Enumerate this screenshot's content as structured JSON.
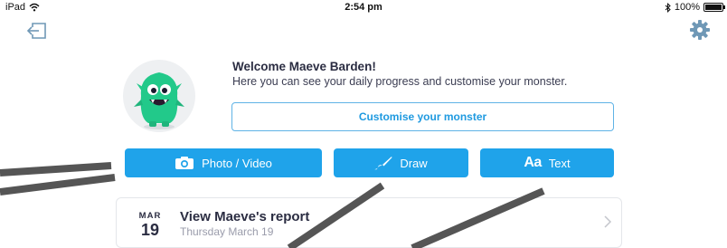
{
  "status_bar": {
    "device": "iPad",
    "time": "2:54 pm",
    "battery": "100%",
    "battery_level": 1.0
  },
  "icons": {
    "logout": "logout-icon",
    "settings": "gear-icon",
    "camera": "camera-icon",
    "brush": "brush-icon",
    "wifi": "wifi-icon",
    "bluetooth": "bluetooth-icon"
  },
  "welcome": {
    "title": "Welcome Maeve Barden!",
    "text": "Here you can see your daily progress and customise your monster.",
    "customise_label": "Customise your monster"
  },
  "actions": {
    "photo_label": "Photo / Video",
    "draw_label": "Draw",
    "text_label": "Text",
    "text_glyph": "Aa"
  },
  "report": {
    "month": "MAR",
    "day": "19",
    "title": "View Maeve's report",
    "subtitle": "Thursday March 19"
  },
  "colors": {
    "accent": "#1fa3ea",
    "monster": "#22c98a",
    "overlay_stroke": "#555555"
  }
}
